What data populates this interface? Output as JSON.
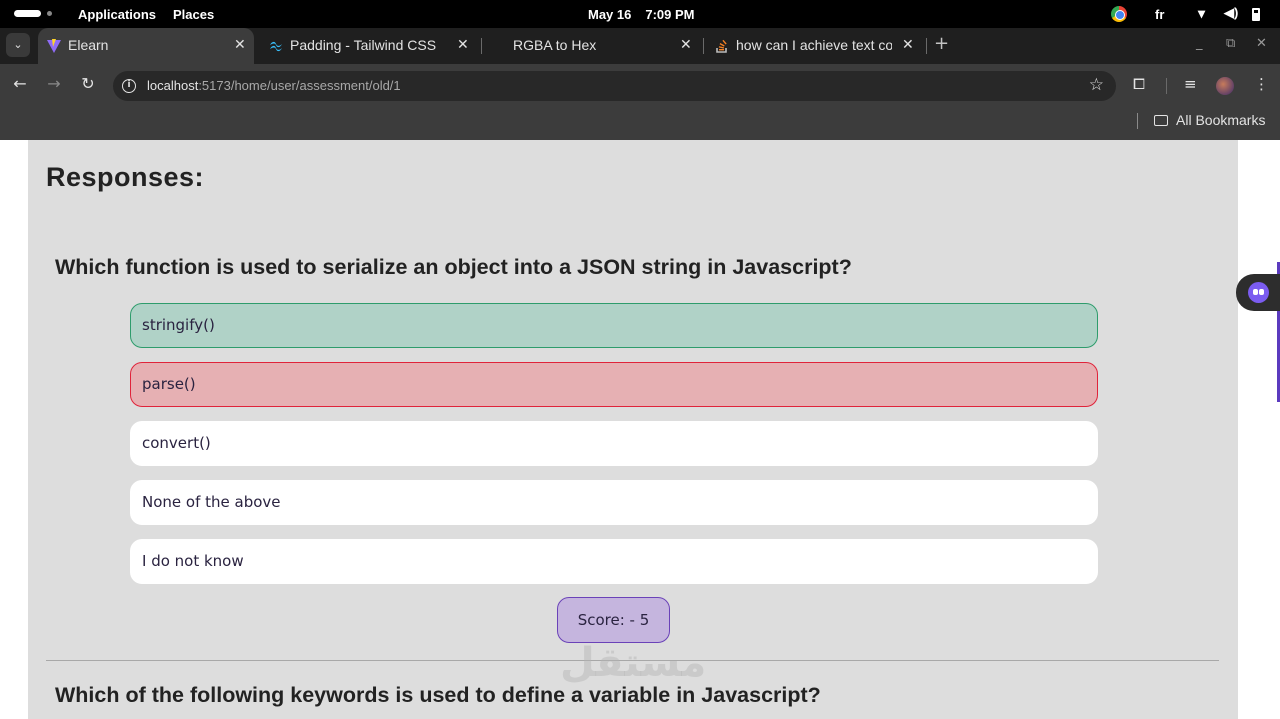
{
  "system_bar": {
    "applications": "Applications",
    "places": "Places",
    "date": "May 16",
    "time": "7:09 PM",
    "language": "fr"
  },
  "browser": {
    "tabs": [
      {
        "title": "Elearn",
        "active": true
      },
      {
        "title": "Padding - Tailwind CSS",
        "active": false
      },
      {
        "title": "RGBA to Hex",
        "active": false
      },
      {
        "title": "how can I achieve text co",
        "active": false
      }
    ],
    "url_host": "localhost",
    "url_rest": ":5173/home/user/assessment/old/1",
    "bookmarks_label": "All Bookmarks"
  },
  "content": {
    "heading": "Responses:",
    "questions": [
      {
        "text": "Which function is used to serialize an object into a JSON string in Javascript?",
        "options": [
          {
            "label": "stringify()",
            "state": "correct"
          },
          {
            "label": "parse()",
            "state": "wrong"
          },
          {
            "label": "convert()",
            "state": "neutral"
          },
          {
            "label": "None of the above",
            "state": "neutral"
          },
          {
            "label": "I do not know",
            "state": "neutral"
          }
        ],
        "score": "Score: - 5"
      },
      {
        "text": "Which of the following keywords is used to define a variable in Javascript?"
      }
    ]
  },
  "colors": {
    "correct_bg": "#b0d2c7",
    "correct_border": "#2e9c6c",
    "wrong_bg": "#e6b0b3",
    "wrong_border": "#e0233a",
    "score_bg": "#c5b5de",
    "panel_bg": "#dddddd"
  },
  "watermark": "مستقل"
}
